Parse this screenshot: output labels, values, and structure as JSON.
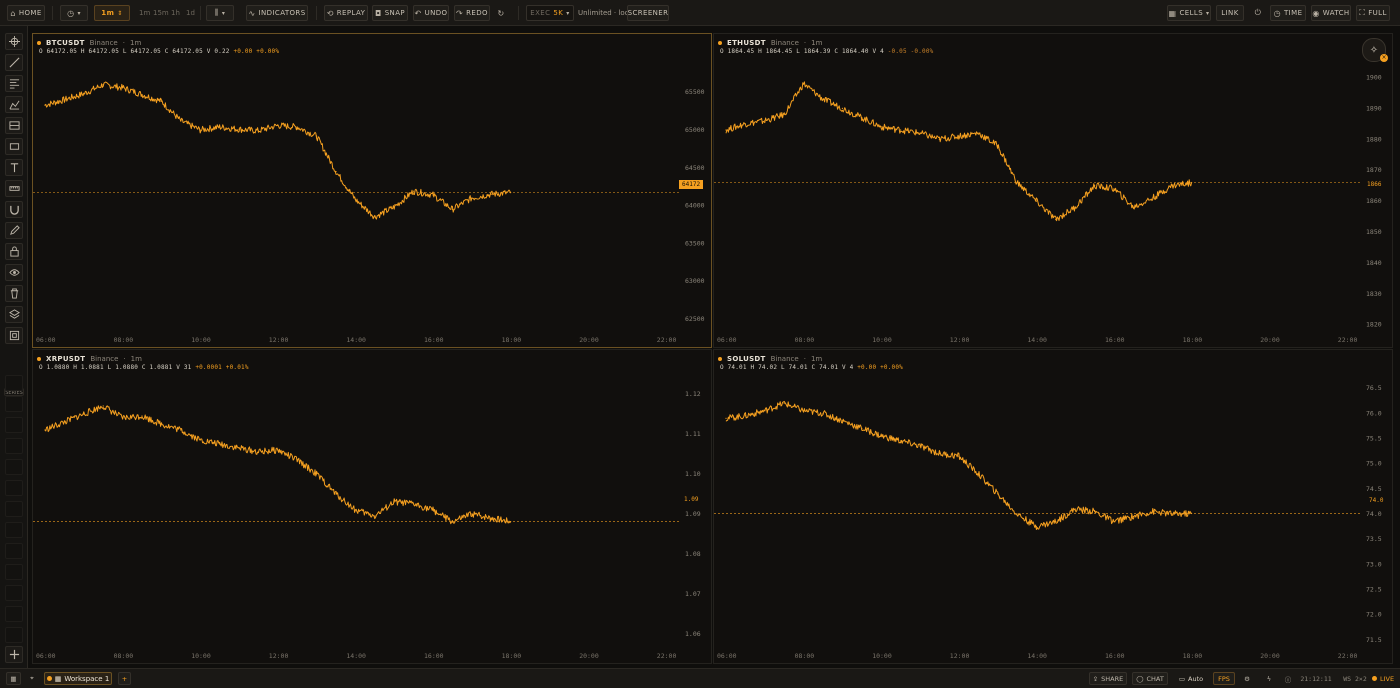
{
  "toolbar": {
    "home": "HOME",
    "interval": "1m",
    "quick_intervals": [
      "1m",
      "15m",
      "1h",
      "1d"
    ],
    "indicators": "INDICATORS",
    "replay": "REPLAY",
    "snap": "SNAP",
    "undo": "UNDO",
    "redo": "REDO",
    "exec_label": "EXEC",
    "exec_value": "5K",
    "mode_text": "Unlimited · local",
    "screener": "SCREENER",
    "cells": "CELLS",
    "link": "LINK",
    "time": "TIME",
    "watch": "WATCH",
    "full": "FULL"
  },
  "colors": {
    "accent": "#f5a020",
    "background": "#110f0d",
    "line": "#f5a020",
    "panel_border_active": "#6b5122"
  },
  "left_tools": {
    "icons": [
      "crosshair-icon",
      "trend-line-icon",
      "fib-icon",
      "pattern-icon",
      "measure-icon",
      "rectangle-icon",
      "text-icon",
      "ruler-icon",
      "magnet-icon",
      "pencil-icon",
      "lock-icon",
      "eye-icon",
      "trash-icon",
      "layers-icon",
      "object-tree-icon"
    ],
    "series_tag": "SERIES",
    "add_icon": "plus-icon"
  },
  "x_ticks": [
    "06:00",
    "08:00",
    "10:00",
    "12:00",
    "14:00",
    "16:00",
    "18:00",
    "20:00",
    "22:00"
  ],
  "panels": [
    {
      "symbol": "BTCUSDT",
      "exchange": "Binance",
      "sep": "·",
      "interval": "1m",
      "ohlc_text": "O 64172.05 H 64172.05 L 64172.05 C 64172.05 V 0.22",
      "change": "+0.00 +0.00%",
      "price_tag": "64172",
      "y_ticks": [
        "65500",
        "65000",
        "64500",
        "64000",
        "63500",
        "63000",
        "62500"
      ]
    },
    {
      "symbol": "ETHUSDT",
      "exchange": "Binance",
      "sep": "·",
      "interval": "1m",
      "ohlc_text": "O 1864.45 H 1864.45 L 1864.39 C 1864.40 V 4",
      "change": "-0.05 -0.00%",
      "price_tag": "1866",
      "y_ticks": [
        "1900",
        "1890",
        "1880",
        "1870",
        "1860",
        "1850",
        "1840",
        "1830",
        "1820"
      ]
    },
    {
      "symbol": "XRPUSDT",
      "exchange": "Binance",
      "sep": "·",
      "interval": "1m",
      "ohlc_text": "O 1.0880 H 1.0881 L 1.0880 C 1.0881 V 31",
      "change": "+0.0001 +0.01%",
      "price_tag": "1.09",
      "y_ticks": [
        "1.12",
        "1.11",
        "1.10",
        "1.09",
        "1.08",
        "1.07",
        "1.06"
      ]
    },
    {
      "symbol": "SOLUSDT",
      "exchange": "Binance",
      "sep": "·",
      "interval": "1m",
      "ohlc_text": "O 74.01 H 74.02 L 74.01 C 74.01 V 4",
      "change": "+0.00 +0.00%",
      "price_tag": "74.0",
      "y_ticks": [
        "76.5",
        "76.0",
        "75.5",
        "75.0",
        "74.5",
        "74.0",
        "73.5",
        "73.0",
        "72.5",
        "72.0",
        "71.5"
      ]
    }
  ],
  "chart_data": [
    {
      "type": "line",
      "title": "BTCUSDT",
      "xlabel": "",
      "ylabel": "",
      "x": [
        "06:00",
        "06:30",
        "07:00",
        "07:30",
        "08:00",
        "08:30",
        "09:00",
        "09:30",
        "10:00",
        "10:30",
        "11:00",
        "11:30",
        "12:00",
        "12:30",
        "13:00",
        "13:30",
        "14:00",
        "14:30",
        "15:00",
        "15:30",
        "16:00",
        "16:30",
        "17:00",
        "17:30",
        "18:00"
      ],
      "series": [
        {
          "values": [
            65330,
            65400,
            65480,
            65600,
            65560,
            65470,
            65380,
            65120,
            65000,
            65040,
            65010,
            64990,
            65060,
            65040,
            64920,
            64450,
            64080,
            63850,
            63980,
            64190,
            64140,
            63950,
            64100,
            64150,
            64172
          ]
        }
      ],
      "ylim": [
        62300,
        65900
      ],
      "last_price": 64172,
      "grid": false
    },
    {
      "type": "line",
      "title": "ETHUSDT",
      "xlabel": "",
      "ylabel": "",
      "x": [
        "06:00",
        "06:30",
        "07:00",
        "07:30",
        "08:00",
        "08:30",
        "09:00",
        "09:30",
        "10:00",
        "10:30",
        "11:00",
        "11:30",
        "12:00",
        "12:30",
        "13:00",
        "13:30",
        "14:00",
        "14:30",
        "15:00",
        "15:30",
        "16:00",
        "16:30",
        "17:00",
        "17:30",
        "18:00"
      ],
      "series": [
        {
          "values": [
            1883,
            1885,
            1886,
            1888,
            1898,
            1893,
            1890,
            1887,
            1884,
            1883,
            1882,
            1880,
            1881,
            1882,
            1878,
            1866,
            1860,
            1854,
            1858,
            1865,
            1864,
            1858,
            1861,
            1865,
            1866
          ]
        }
      ],
      "ylim": [
        1817,
        1905
      ],
      "last_price": 1866,
      "grid": false
    },
    {
      "type": "line",
      "title": "XRPUSDT",
      "xlabel": "",
      "ylabel": "",
      "x": [
        "06:00",
        "06:30",
        "07:00",
        "07:30",
        "08:00",
        "08:30",
        "09:00",
        "09:30",
        "10:00",
        "10:30",
        "11:00",
        "11:30",
        "12:00",
        "12:30",
        "13:00",
        "13:30",
        "14:00",
        "14:30",
        "15:00",
        "15:30",
        "16:00",
        "16:30",
        "17:00",
        "17:30",
        "18:00"
      ],
      "series": [
        {
          "values": [
            1.111,
            1.113,
            1.115,
            1.117,
            1.114,
            1.1145,
            1.1125,
            1.111,
            1.1085,
            1.1075,
            1.1065,
            1.1055,
            1.106,
            1.1035,
            1.1,
            1.095,
            1.091,
            1.0895,
            1.093,
            1.0925,
            1.091,
            1.088,
            1.09,
            1.089,
            1.0881
          ]
        }
      ],
      "ylim": [
        1.056,
        1.124
      ],
      "last_price": 1.0881,
      "grid": false
    },
    {
      "type": "line",
      "title": "SOLUSDT",
      "xlabel": "",
      "ylabel": "",
      "x": [
        "06:00",
        "06:30",
        "07:00",
        "07:30",
        "08:00",
        "08:30",
        "09:00",
        "09:30",
        "10:00",
        "10:30",
        "11:00",
        "11:30",
        "12:00",
        "12:30",
        "13:00",
        "13:30",
        "14:00",
        "14:30",
        "15:00",
        "15:30",
        "16:00",
        "16:30",
        "17:00",
        "17:30",
        "18:00"
      ],
      "series": [
        {
          "values": [
            75.9,
            75.95,
            76.05,
            76.2,
            76.05,
            76.0,
            75.85,
            75.7,
            75.55,
            75.45,
            75.35,
            75.2,
            75.15,
            74.8,
            74.4,
            74.0,
            73.75,
            73.85,
            74.1,
            74.05,
            73.85,
            73.95,
            74.05,
            74.0,
            74.01
          ]
        }
      ],
      "ylim": [
        71.3,
        76.7
      ],
      "last_price": 74.01,
      "grid": false
    }
  ],
  "bottom": {
    "workspace": "Workspace 1",
    "add": "+",
    "share": "SHARE",
    "chat": "CHAT",
    "auto": "Auto",
    "fps": "FPS",
    "clock": "21:12:11",
    "layout": "WS 2×2",
    "live": "LIVE"
  }
}
